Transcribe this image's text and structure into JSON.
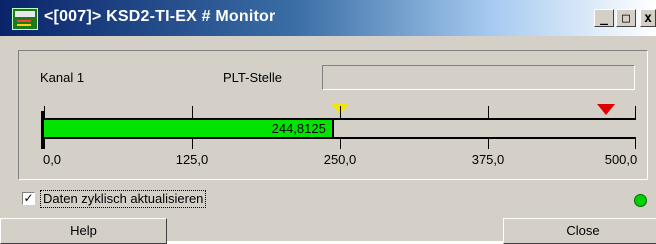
{
  "window": {
    "title": "<[007]> KSD2-TI-EX # Monitor",
    "controls": {
      "minimize": "_",
      "maximize": "□",
      "close": "x"
    }
  },
  "channel": {
    "label": "Kanal 1"
  },
  "plt": {
    "label": "PLT-Stelle",
    "value": ""
  },
  "gauge": {
    "value": 244.8125,
    "value_text": "244,8125",
    "min": 0,
    "max": 500,
    "ticks": [
      "0,0",
      "125,0",
      "250,0",
      "375,0",
      "500,0"
    ],
    "colors": {
      "fill": "#00e400",
      "low_marker": "#f4e400",
      "high_marker": "#e00000"
    },
    "markers": [
      {
        "name": "yellow-limit",
        "value": 250
      },
      {
        "name": "red-limit",
        "value": 475
      }
    ]
  },
  "options": {
    "cyclic_update_label": "Daten zyklisch aktualisieren",
    "cyclic_update_checked": true,
    "check_glyph": "✓"
  },
  "status": {
    "led_color": "#00d000"
  },
  "buttons": {
    "help": "Help",
    "close": "Close"
  }
}
